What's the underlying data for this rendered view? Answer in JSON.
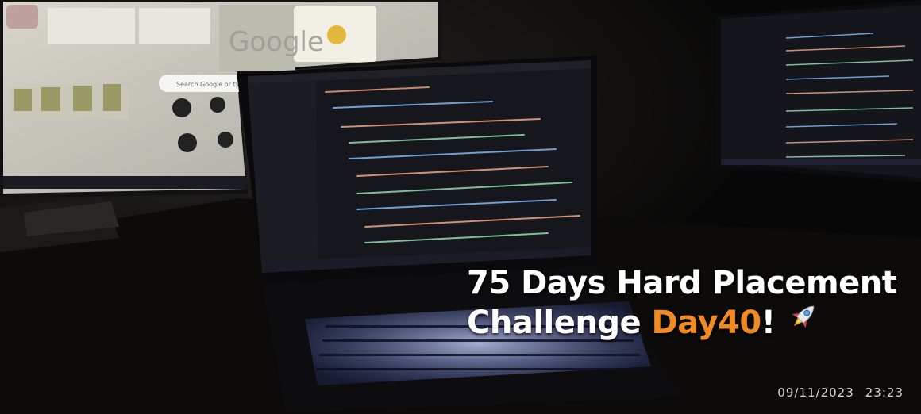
{
  "scene": {
    "monitor": {
      "google_logo": "Google",
      "search_placeholder": "Search Google or type a URL"
    }
  },
  "caption": {
    "line1": "75 Days Hard Placement",
    "line2_prefix": "Challenge ",
    "line2_highlight": "Day40",
    "line2_suffix": "!",
    "icon": "rocket-icon"
  },
  "timestamp": {
    "date": "09/11/2023",
    "time": "23:23"
  },
  "colors": {
    "background": "#070707",
    "highlight": "#f08a24",
    "text": "#ffffff",
    "keyboard_glow": "#aab8ff"
  }
}
